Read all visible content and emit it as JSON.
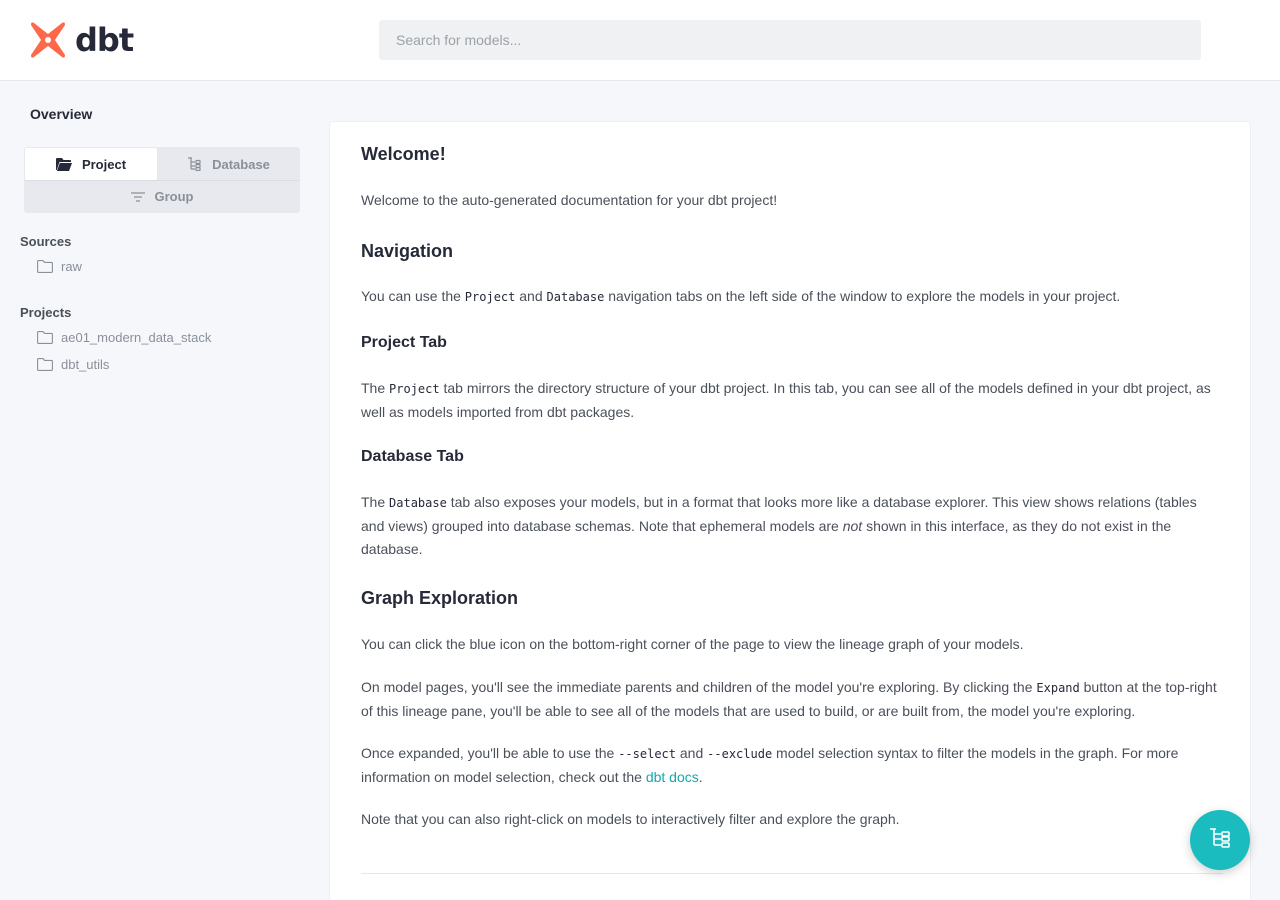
{
  "header": {
    "logo_text": "dbt",
    "logo_icon": "dbt-logo-icon",
    "search_placeholder": "Search for models..."
  },
  "sidebar": {
    "overview_label": "Overview",
    "tabs": {
      "project": {
        "label": "Project",
        "icon": "folder-open-icon"
      },
      "database": {
        "label": "Database",
        "icon": "tree-icon"
      },
      "group": {
        "label": "Group",
        "icon": "filter-lines-icon"
      }
    },
    "sources": {
      "title": "Sources",
      "items": [
        {
          "label": "raw",
          "icon": "folder-icon"
        }
      ]
    },
    "projects": {
      "title": "Projects",
      "items": [
        {
          "label": "ae01_modern_data_stack",
          "icon": "folder-icon"
        },
        {
          "label": "dbt_utils",
          "icon": "folder-icon"
        }
      ]
    }
  },
  "main": {
    "welcome_heading": "Welcome!",
    "welcome_text": "Welcome to the auto-generated documentation for your dbt project!",
    "navigation_heading": "Navigation",
    "navigation_text": {
      "t1": "You can use the ",
      "c1": "Project",
      "t2": " and ",
      "c2": "Database",
      "t3": " navigation tabs on the left side of the window to explore the models in your project."
    },
    "project_tab_heading": "Project Tab",
    "project_tab_text": {
      "t1": "The ",
      "c1": "Project",
      "t2": " tab mirrors the directory structure of your dbt project. In this tab, you can see all of the models defined in your dbt project, as well as models imported from dbt packages."
    },
    "database_tab_heading": "Database Tab",
    "database_tab_text": {
      "t1": "The ",
      "c1": "Database",
      "t2": " tab also exposes your models, but in a format that looks more like a database explorer. This view shows relations (tables and views) grouped into database schemas. Note that ephemeral models are ",
      "em": "not",
      "t3": " shown in this interface, as they do not exist in the database."
    },
    "graph_heading": "Graph Exploration",
    "graph_p1": "You can click the blue icon on the bottom-right corner of the page to view the lineage graph of your models.",
    "graph_p2": {
      "t1": "On model pages, you'll see the immediate parents and children of the model you're exploring. By clicking the ",
      "c1": "Expand",
      "t2": " button at the top-right of this lineage pane, you'll be able to see all of the models that are used to build, or are built from, the model you're exploring."
    },
    "graph_p3": {
      "t1": "Once expanded, you'll be able to use the ",
      "c1": "--select",
      "t2": " and ",
      "c2": "--exclude",
      "t3": " model selection syntax to filter the models in the graph. For more information on model selection, check out the ",
      "link": "dbt docs",
      "t4": "."
    },
    "graph_p4": "Note that you can also right-click on models to interactively filter and explore the graph."
  },
  "fab": {
    "icon": "lineage-graph-icon"
  },
  "colors": {
    "accent": "#1bbcbf",
    "link": "#13a8ac",
    "logo": "#ff694b"
  }
}
